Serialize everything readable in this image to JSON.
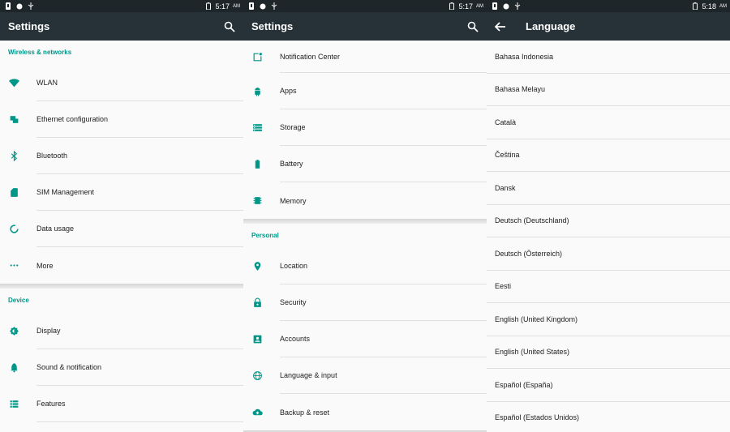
{
  "status": {
    "time1": "5:17",
    "time2": "5:17",
    "time3": "5:18",
    "ampm": "AM"
  },
  "screen1": {
    "title": "Settings",
    "section_wireless": "Wireless & networks",
    "section_device": "Device",
    "items": [
      {
        "label": "WLAN",
        "icon": "wifi-icon"
      },
      {
        "label": "Ethernet configuration",
        "icon": "ethernet-icon"
      },
      {
        "label": "Bluetooth",
        "icon": "bluetooth-icon"
      },
      {
        "label": "SIM Management",
        "icon": "sim-card-icon"
      },
      {
        "label": "Data usage",
        "icon": "data-usage-icon"
      },
      {
        "label": "More",
        "icon": "more-dots-icon"
      }
    ],
    "device_items": [
      {
        "label": "Display",
        "icon": "brightness-icon"
      },
      {
        "label": "Sound & notification",
        "icon": "bell-icon"
      },
      {
        "label": "Features",
        "icon": "list-icon"
      }
    ]
  },
  "screen2": {
    "title": "Settings",
    "items": [
      {
        "label": "Notification Center",
        "icon": "notification-center-icon"
      },
      {
        "label": "Apps",
        "icon": "android-icon"
      },
      {
        "label": "Storage",
        "icon": "storage-icon"
      },
      {
        "label": "Battery",
        "icon": "battery-icon"
      },
      {
        "label": "Memory",
        "icon": "memory-chip-icon"
      }
    ],
    "section_personal": "Personal",
    "personal_items": [
      {
        "label": "Location",
        "icon": "location-pin-icon"
      },
      {
        "label": "Security",
        "icon": "lock-icon"
      },
      {
        "label": "Accounts",
        "icon": "account-icon"
      },
      {
        "label": "Language & input",
        "icon": "globe-icon"
      },
      {
        "label": "Backup & reset",
        "icon": "cloud-upload-icon"
      }
    ]
  },
  "screen3": {
    "title": "Language",
    "languages": [
      "Bahasa Indonesia",
      "Bahasa Melayu",
      "Català",
      "Čeština",
      "Dansk",
      "Deutsch (Deutschland)",
      "Deutsch (Österreich)",
      "Eesti",
      "English (United Kingdom)",
      "English (United States)",
      "Español (España)",
      "Español (Estados Unidos)"
    ]
  },
  "colors": {
    "accent": "#009688",
    "appbar": "#263238",
    "statusbar": "#1f2629"
  }
}
